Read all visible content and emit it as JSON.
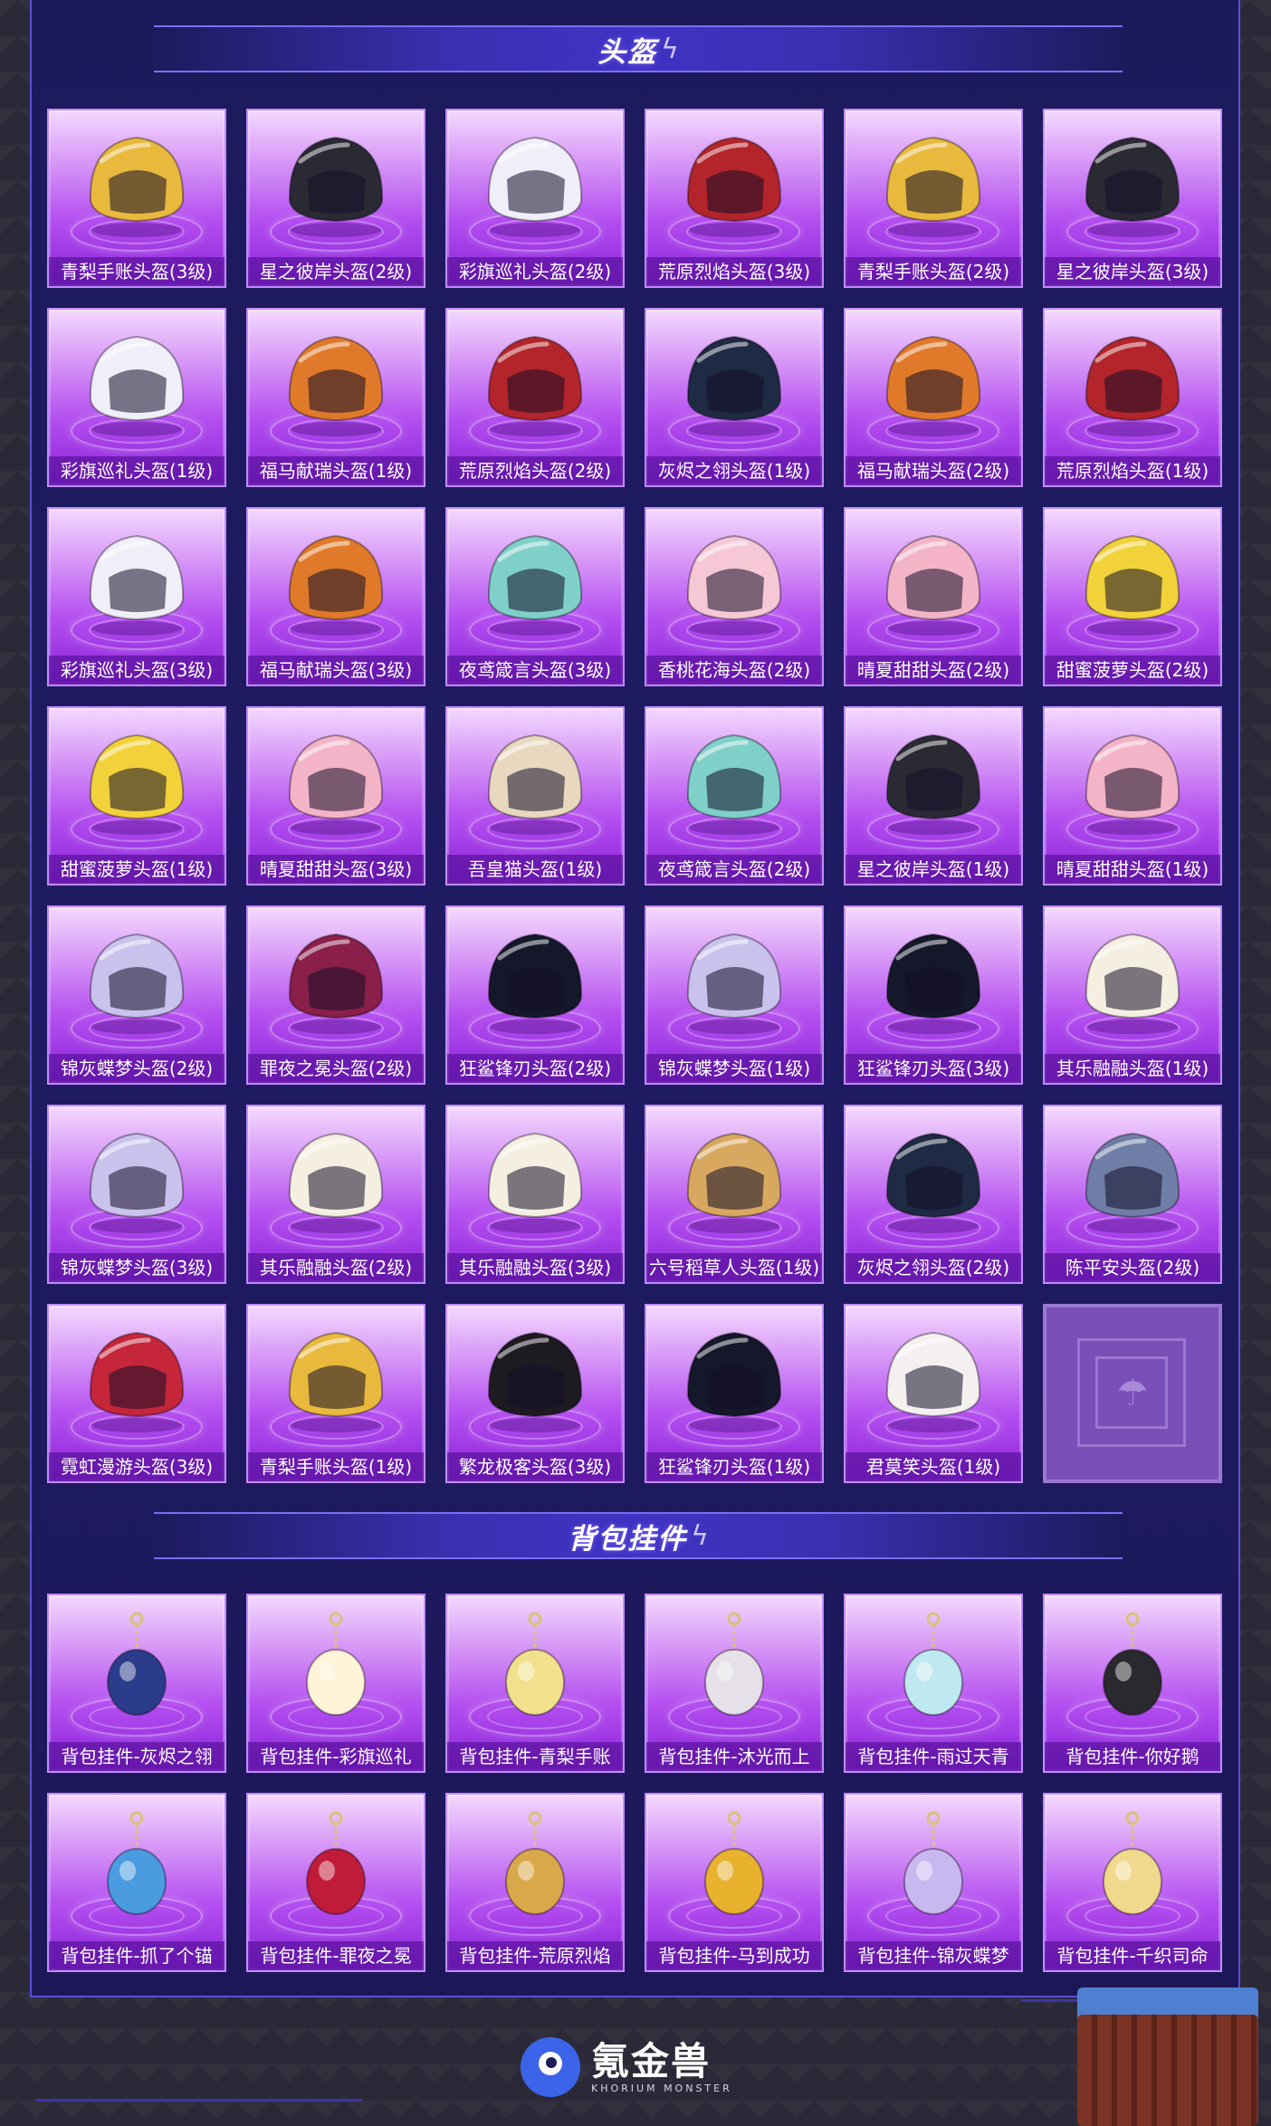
{
  "helmet_section": {
    "title": "头盔",
    "icon": "lightning-icon"
  },
  "helmets": [
    {
      "label": "青梨手账头盔(3级)",
      "color": "#e8b93c"
    },
    {
      "label": "星之彼岸头盔(2级)",
      "color": "#2a2a35"
    },
    {
      "label": "彩旗巡礼头盔(2级)",
      "color": "#f0eef8"
    },
    {
      "label": "荒原烈焰头盔(3级)",
      "color": "#b3252a"
    },
    {
      "label": "青梨手账头盔(2级)",
      "color": "#e8b93c"
    },
    {
      "label": "星之彼岸头盔(3级)",
      "color": "#2a2a35"
    },
    {
      "label": "彩旗巡礼头盔(1级)",
      "color": "#f0eef8"
    },
    {
      "label": "福马献瑞头盔(1级)",
      "color": "#e07a2a"
    },
    {
      "label": "荒原烈焰头盔(2级)",
      "color": "#b3252a"
    },
    {
      "label": "灰烬之翎头盔(1级)",
      "color": "#1f2a44"
    },
    {
      "label": "福马献瑞头盔(2级)",
      "color": "#e07a2a"
    },
    {
      "label": "荒原烈焰头盔(1级)",
      "color": "#b3252a"
    },
    {
      "label": "彩旗巡礼头盔(3级)",
      "color": "#f0eef8"
    },
    {
      "label": "福马献瑞头盔(3级)",
      "color": "#e07a2a"
    },
    {
      "label": "夜鸢箴言头盔(3级)",
      "color": "#7fd0c8"
    },
    {
      "label": "香桃花海头盔(2级)",
      "color": "#f6c8d6"
    },
    {
      "label": "晴夏甜甜头盔(2级)",
      "color": "#f4b4c8"
    },
    {
      "label": "甜蜜菠萝头盔(2级)",
      "color": "#f2d23a"
    },
    {
      "label": "甜蜜菠萝头盔(1级)",
      "color": "#f2d23a"
    },
    {
      "label": "晴夏甜甜头盔(3级)",
      "color": "#f4b4c8"
    },
    {
      "label": "吾皇猫头盔(1级)",
      "color": "#e8d8c0"
    },
    {
      "label": "夜鸢箴言头盔(2级)",
      "color": "#7fd0c8"
    },
    {
      "label": "星之彼岸头盔(1级)",
      "color": "#2a2a35"
    },
    {
      "label": "晴夏甜甜头盔(1级)",
      "color": "#f4b4c8"
    },
    {
      "label": "锦灰蝶梦头盔(2级)",
      "color": "#c9c2ec"
    },
    {
      "label": "罪夜之冕头盔(2级)",
      "color": "#8a1f4a"
    },
    {
      "label": "狂鲨锋刃头盔(2级)",
      "color": "#15182a"
    },
    {
      "label": "锦灰蝶梦头盔(1级)",
      "color": "#c9c2ec"
    },
    {
      "label": "狂鲨锋刃头盔(3级)",
      "color": "#15182a"
    },
    {
      "label": "其乐融融头盔(1级)",
      "color": "#f5efe2"
    },
    {
      "label": "锦灰蝶梦头盔(3级)",
      "color": "#c9c2ec"
    },
    {
      "label": "其乐融融头盔(2级)",
      "color": "#f5efe2"
    },
    {
      "label": "其乐融融头盔(3级)",
      "color": "#f5efe2"
    },
    {
      "label": "六号稻草人头盔(1级)",
      "color": "#d9a860"
    },
    {
      "label": "灰烬之翎头盔(2级)",
      "color": "#1f2a44"
    },
    {
      "label": "陈平安头盔(2级)",
      "color": "#6f7ea6"
    },
    {
      "label": "霓虹漫游头盔(3级)",
      "color": "#c5263a"
    },
    {
      "label": "青梨手账头盔(1级)",
      "color": "#e8b93c"
    },
    {
      "label": "繁龙极客头盔(3级)",
      "color": "#1e1a22"
    },
    {
      "label": "狂鲨锋刃头盔(1级)",
      "color": "#15182a"
    },
    {
      "label": "君莫笑头盔(1级)",
      "color": "#f4f0f0"
    }
  ],
  "empty_slot": {
    "icon": "airdrop-parachute-icon"
  },
  "backpack_section": {
    "title": "背包挂件",
    "icon": "lightning-icon"
  },
  "charms": [
    {
      "label": "背包挂件-灰烬之翎",
      "color": "#2c3c8c"
    },
    {
      "label": "背包挂件-彩旗巡礼",
      "color": "#fff3d8"
    },
    {
      "label": "背包挂件-青梨手账",
      "color": "#f1e08c"
    },
    {
      "label": "背包挂件-沐光而上",
      "color": "#e6e1e8"
    },
    {
      "label": "背包挂件-雨过天青",
      "color": "#bfe8f0"
    },
    {
      "label": "背包挂件-你好鹅",
      "color": "#2a2a2e"
    },
    {
      "label": "背包挂件-抓了个锚",
      "color": "#4a9be0"
    },
    {
      "label": "背包挂件-罪夜之冕",
      "color": "#c01c3a"
    },
    {
      "label": "背包挂件-荒原烈焰",
      "color": "#d9a84a"
    },
    {
      "label": "背包挂件-马到成功",
      "color": "#e8b12e"
    },
    {
      "label": "背包挂件-锦灰蝶梦",
      "color": "#c8b8f0"
    },
    {
      "label": "背包挂件-千织司命",
      "color": "#f0d88c"
    }
  ],
  "footer": {
    "logo_text": "氪金兽",
    "logo_sub": "KHORIUM MONSTER",
    "logo_icon": "monster-eye-icon"
  }
}
